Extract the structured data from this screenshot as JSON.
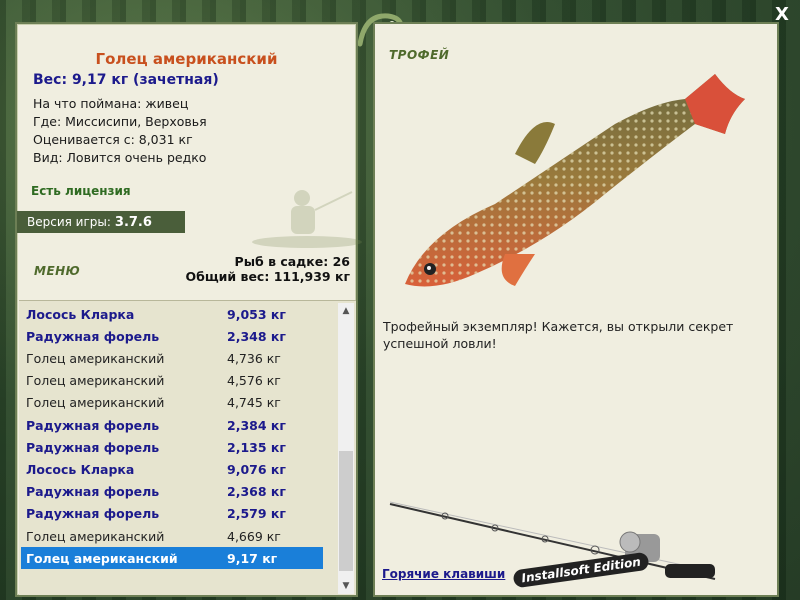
{
  "fish": {
    "title": "Голец американский",
    "weight": "Вес: 9,17 кг (зачетная)",
    "caught_on": "На что поймана: живец",
    "location": "Где: Миссисипи, Верховья",
    "valued_from": "Оценивается с: 8,031 кг",
    "kind": "Вид: Ловится очень редко"
  },
  "license": "Есть лицензия",
  "version": {
    "label": "Версия игры:",
    "value": "3.7.6"
  },
  "menu_label": "МЕНЮ",
  "stats": {
    "fish_count": "Рыб в садке: 26",
    "total_weight": "Общий вес: 111,939 кг"
  },
  "catch_list": [
    {
      "name": "Лосось Кларка",
      "kg": "9,053 кг",
      "style": "bold"
    },
    {
      "name": "Радужная форель",
      "kg": "2,348 кг",
      "style": "bold"
    },
    {
      "name": "Голец американский",
      "kg": "4,736 кг",
      "style": "normal"
    },
    {
      "name": "Голец американский",
      "kg": "4,576 кг",
      "style": "normal"
    },
    {
      "name": "Голец американский",
      "kg": "4,745 кг",
      "style": "normal"
    },
    {
      "name": "Радужная форель",
      "kg": "2,384 кг",
      "style": "bold"
    },
    {
      "name": "Радужная форель",
      "kg": "2,135 кг",
      "style": "bold"
    },
    {
      "name": "Лосось Кларка",
      "kg": "9,076 кг",
      "style": "bold"
    },
    {
      "name": "Радужная форель",
      "kg": "2,368 кг",
      "style": "bold"
    },
    {
      "name": "Радужная форель",
      "kg": "2,579 кг",
      "style": "bold"
    },
    {
      "name": "Голец американский",
      "kg": "4,669 кг",
      "style": "normal"
    },
    {
      "name": "Голец американский",
      "kg": "9,17 кг",
      "style": "selected"
    }
  ],
  "trophy": {
    "label": "ТРОФЕЙ",
    "text": "Трофейный экземпляр! Кажется, вы открыли секрет успешной ловли!"
  },
  "hotkeys": "Горячие клавиши",
  "edition": "Installsoft Edition",
  "close": "X",
  "colors": {
    "title": "#c8501e",
    "accent_blue": "#1c1a8c",
    "selection": "#1a7fd9",
    "panel_bg": "#f0eee0",
    "license_green": "#2f6b22"
  }
}
